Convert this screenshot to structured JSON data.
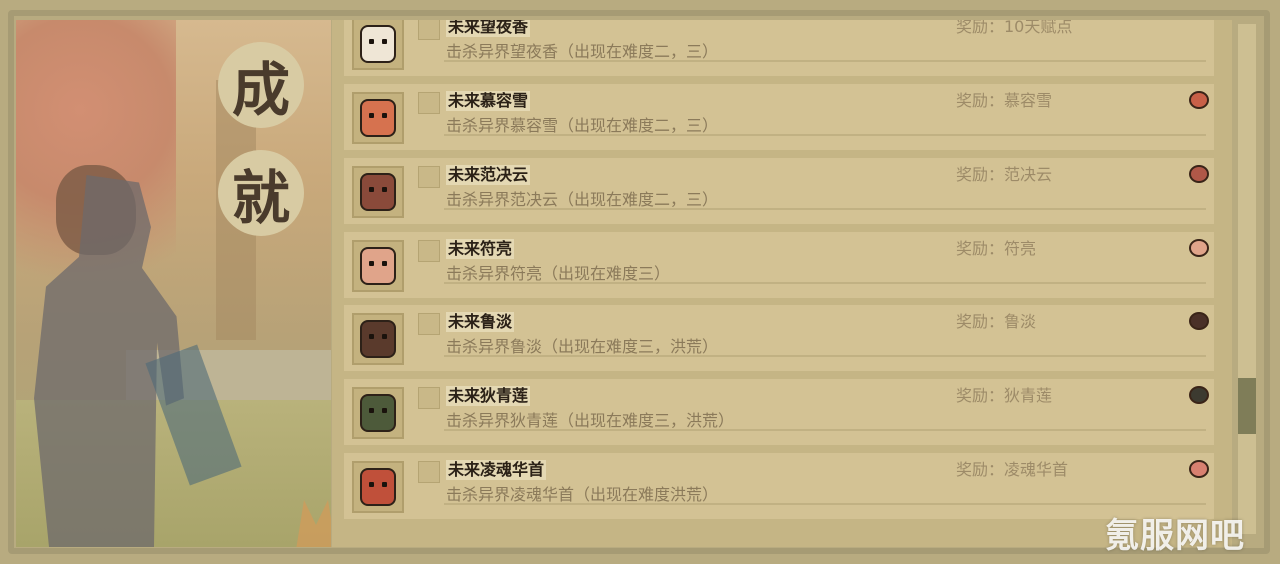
{
  "side_badges": [
    "成",
    "就"
  ],
  "watermark": "氪服网吧",
  "achievements": [
    {
      "title": "未来望夜香",
      "desc": "击杀异界望夜香（出现在难度二，三）",
      "reward": "奖励：10天赋点",
      "face_color": "#efe6d6",
      "reward_icon": ""
    },
    {
      "title": "未来慕容雪",
      "desc": "击杀异界慕容雪（出现在难度二，三）",
      "reward": "奖励：慕容雪",
      "face_color": "#d6724f",
      "reward_icon": "#c86048"
    },
    {
      "title": "未来范决云",
      "desc": "击杀异界范决云（出现在难度二，三）",
      "reward": "奖励：范决云",
      "face_color": "#8a4a3a",
      "reward_icon": "#b05848"
    },
    {
      "title": "未来符亮",
      "desc": "击杀异界符亮（出现在难度三）",
      "reward": "奖励：符亮",
      "face_color": "#e0a48a",
      "reward_icon": "#e0a48a"
    },
    {
      "title": "未来鲁淡",
      "desc": "击杀异界鲁淡（出现在难度三，洪荒）",
      "reward": "奖励：鲁淡",
      "face_color": "#5a3a2c",
      "reward_icon": "#4a3028"
    },
    {
      "title": "未来狄青莲",
      "desc": "击杀异界狄青莲（出现在难度三，洪荒）",
      "reward": "奖励：狄青莲",
      "face_color": "#4d5a3a",
      "reward_icon": "#3c3a30"
    },
    {
      "title": "未来凌魂华首",
      "desc": "击杀异界凌魂华首（出现在难度洪荒）",
      "reward": "奖励：凌魂华首",
      "face_color": "#c0503a",
      "reward_icon": "#d88070"
    }
  ]
}
